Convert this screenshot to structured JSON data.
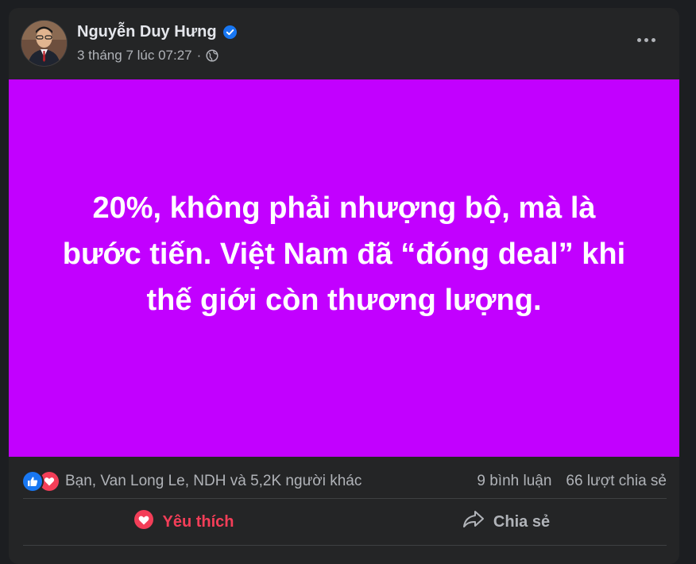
{
  "post": {
    "author": "Nguyễn Duy Hưng",
    "timestamp": "3 tháng 7 lúc 07:27",
    "separator": "·",
    "banner_lines": [
      "20%, không phải nhượng bộ, mà là",
      "bước tiến. Việt Nam đã “đóng deal” khi",
      "thế giới còn thương lượng."
    ],
    "banner_color": "#c200ff"
  },
  "reactions": {
    "summary": "Bạn, Van Long Le, NDH và 5,2K người khác",
    "comments": "9 bình luận",
    "shares": "66 lượt chia sẻ",
    "icons": [
      "like-icon",
      "love-icon"
    ]
  },
  "actions": {
    "like_label": "Yêu thích",
    "share_label": "Chia sẻ"
  },
  "colors": {
    "card_bg": "#242526",
    "text_primary": "#e4e6eb",
    "text_secondary": "#b0b3b8",
    "love": "#f33e58",
    "like": "#1877f2"
  }
}
